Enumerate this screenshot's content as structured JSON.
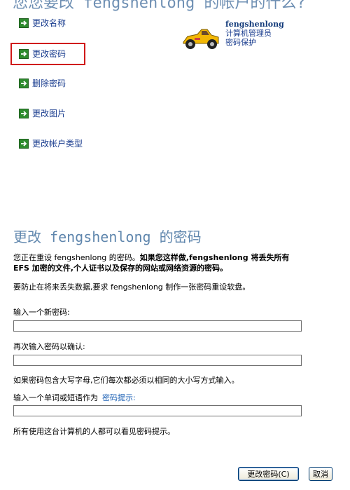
{
  "header": {
    "partial_title": "您您要改 fengshenlong 的帐户的什么?"
  },
  "tasks": [
    {
      "label": "更改名称"
    },
    {
      "label": "更改密码"
    },
    {
      "label": "删除密码"
    },
    {
      "label": "更改图片"
    },
    {
      "label": "更改帐户类型"
    }
  ],
  "user": {
    "name": "fengshenlong",
    "role": "计算机管理员",
    "status": "密码保护",
    "avatar_icon": "race-car-icon"
  },
  "section": {
    "title": "更改 fengshenlong 的密码",
    "warning_normal": "您正在重设 fengshenlong 的密码。",
    "warning_bold": "如果您这样做,fengshenlong 将丢失所有 EFS 加密的文件,个人证书以及保存的网站或网络资源的密码。",
    "prevent_text": "要防止在将来丢失数据,要求 fengshenlong 制作一张密码重设软盘。"
  },
  "form": {
    "new_password_label": "输入一个新密码:",
    "new_password_value": "",
    "confirm_label": "再次输入密码以确认:",
    "confirm_value": "",
    "case_note": "如果密码包含大写字母,它们每次都必须以相同的大小写方式输入。",
    "hint_label": "输入一个单词或短语作为",
    "hint_link": "密码提示:",
    "hint_value": "",
    "visibility_note": "所有使用这台计算机的人都可以看见密码提示。"
  },
  "buttons": {
    "change_password": "更改密码(C)",
    "cancel": "取消"
  },
  "colors": {
    "title_blue": "#5f86ad",
    "link_blue": "#1a3d8f",
    "arrow_green": "#2e8b2e",
    "highlight_red": "#d01818"
  }
}
